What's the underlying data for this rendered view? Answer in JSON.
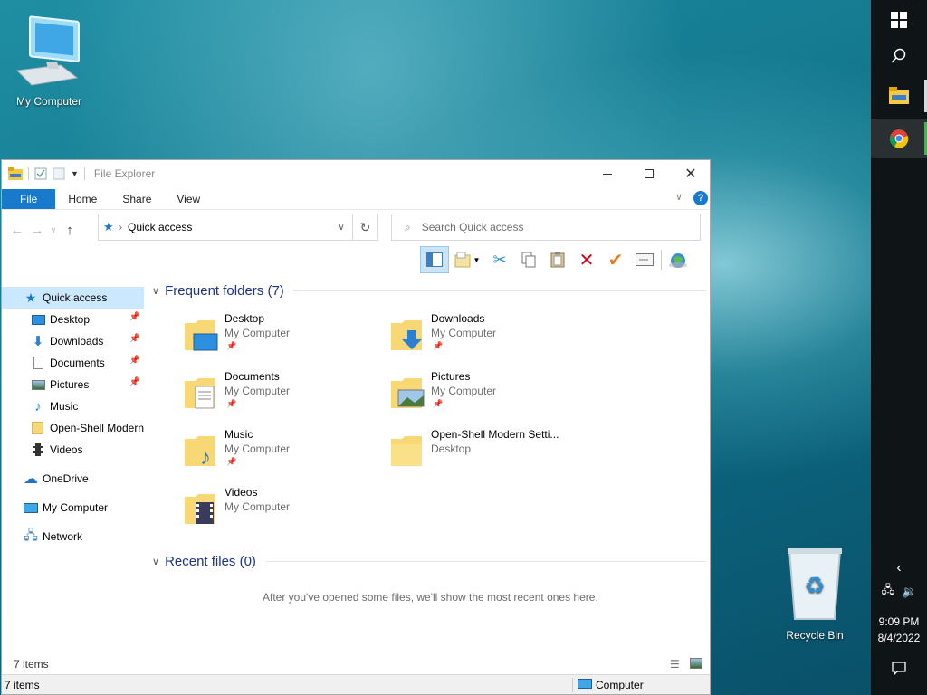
{
  "desktop": {
    "icons": [
      {
        "label": "My Computer"
      },
      {
        "label": "Recycle Bin"
      }
    ]
  },
  "taskbar": {
    "time": "9:09 PM",
    "date": "8/4/2022",
    "accent_colors": {
      "explorer": "#f2c94c",
      "chrome": "#4caf50"
    }
  },
  "window": {
    "title": "File Explorer",
    "tabs": {
      "file": "File",
      "home": "Home",
      "share": "Share",
      "view": "View"
    },
    "address": "Quick access",
    "search_placeholder": "Search Quick access",
    "nav": {
      "quick_access": "Quick access",
      "desktop": "Desktop",
      "downloads": "Downloads",
      "documents": "Documents",
      "pictures": "Pictures",
      "music": "Music",
      "openshell": "Open-Shell Modern",
      "videos": "Videos",
      "onedrive": "OneDrive",
      "mycomputer": "My Computer",
      "network": "Network"
    },
    "frequent_header": "Frequent folders (7)",
    "folders": [
      {
        "name": "Desktop",
        "location": "My Computer"
      },
      {
        "name": "Downloads",
        "location": "My Computer"
      },
      {
        "name": "Documents",
        "location": "My Computer"
      },
      {
        "name": "Pictures",
        "location": "My Computer"
      },
      {
        "name": "Music",
        "location": "My Computer"
      },
      {
        "name": "Open-Shell Modern Setti...",
        "location": "Desktop"
      },
      {
        "name": "Videos",
        "location": "My Computer"
      }
    ],
    "recent_header": "Recent files (0)",
    "recent_message": "After you've opened some files, we'll show the most recent ones here.",
    "status_items": "7 items",
    "bottom_items": "7 items",
    "bottom_location": "Computer"
  }
}
